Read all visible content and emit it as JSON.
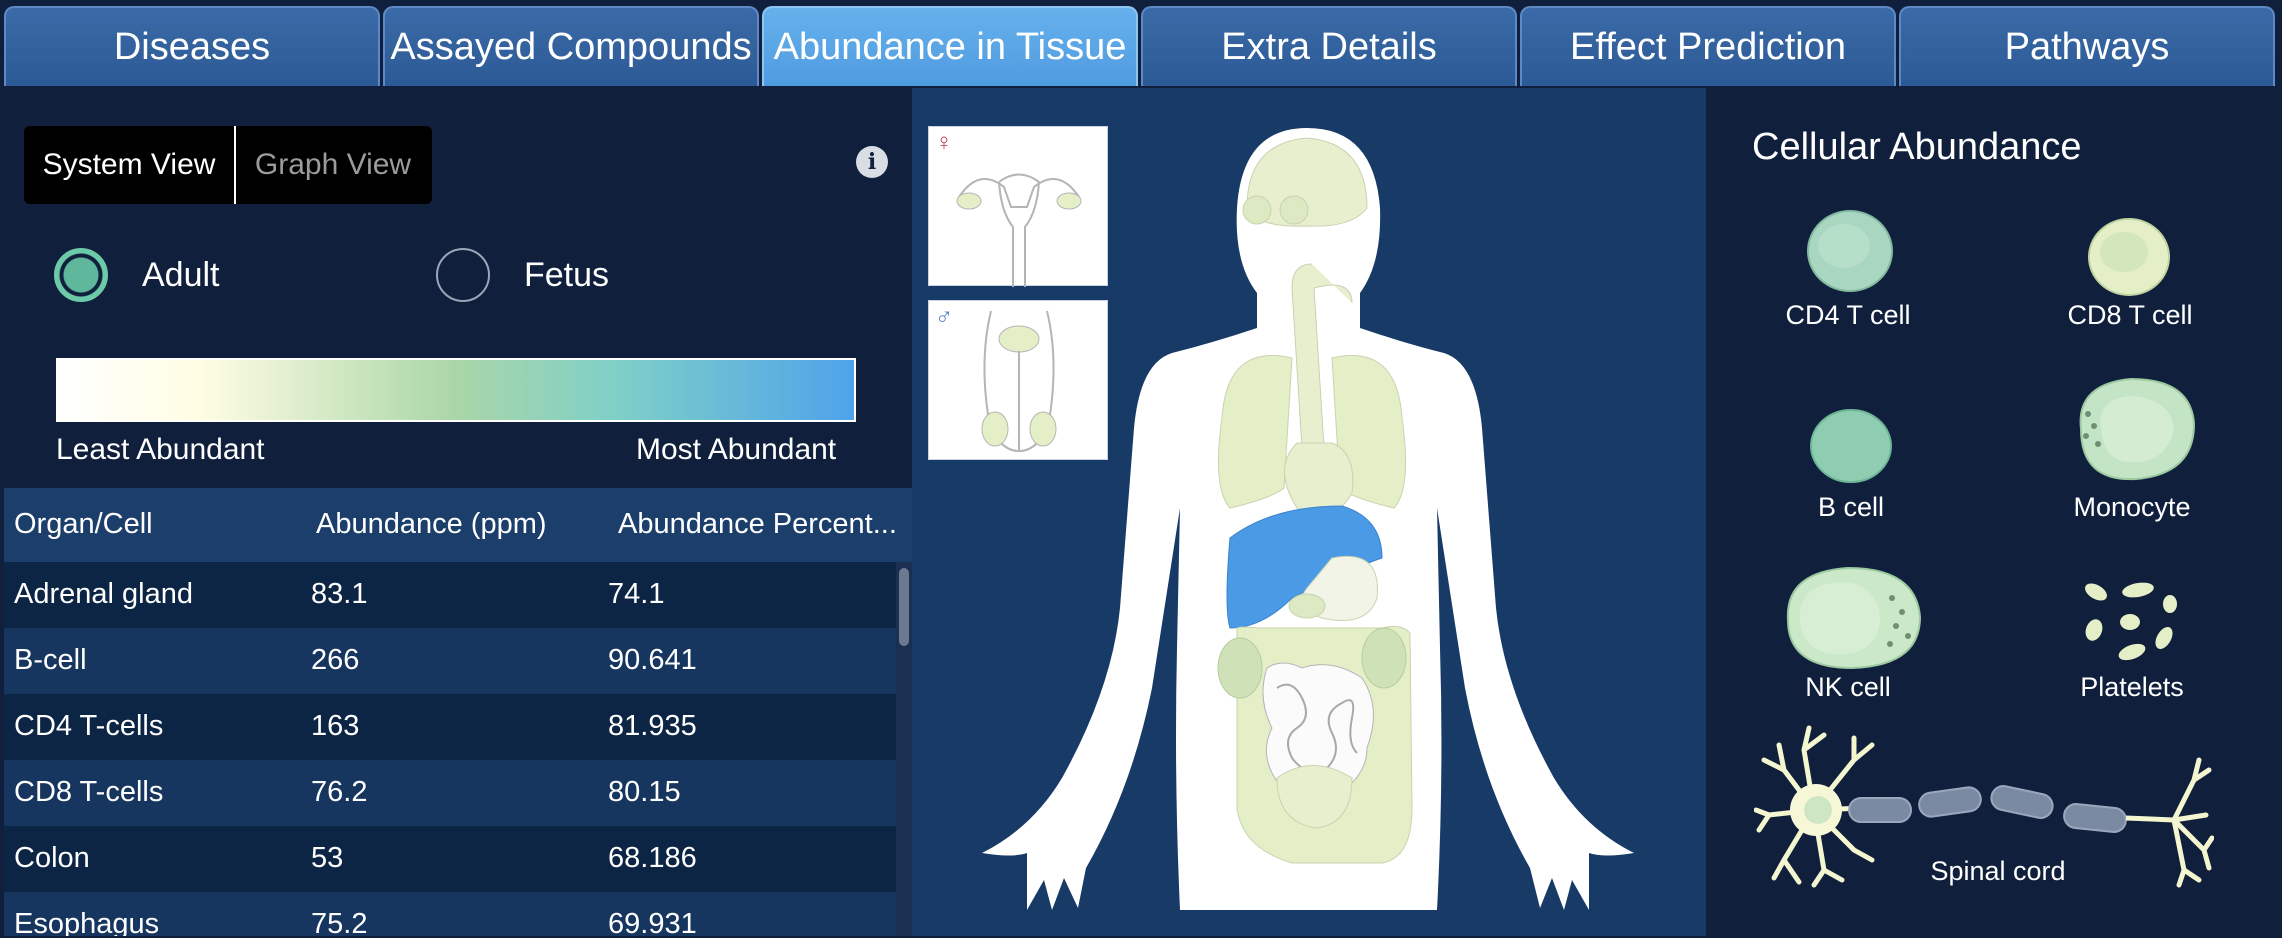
{
  "tabs": [
    "Diseases",
    "Assayed Compounds",
    "Abundance in Tissue",
    "Extra Details",
    "Effect Prediction",
    "Pathways"
  ],
  "active_tab": "Abundance in Tissue",
  "view_toggle": {
    "system": "System View",
    "graph": "Graph View",
    "selected": "System View"
  },
  "info_icon": "i",
  "age": {
    "adult": "Adult",
    "fetus": "Fetus",
    "selected": "Adult"
  },
  "legend": {
    "least": "Least Abundant",
    "most": "Most Abundant"
  },
  "table": {
    "headers": [
      "Organ/Cell",
      "Abundance (ppm)",
      "Abundance Percent..."
    ],
    "rows": [
      [
        "Adrenal gland",
        "83.1",
        "74.1"
      ],
      [
        "B-cell",
        "266",
        "90.641"
      ],
      [
        "CD4 T-cells",
        "163",
        "81.935"
      ],
      [
        "CD8 T-cells",
        "76.2",
        "80.15"
      ],
      [
        "Colon",
        "53",
        "68.186"
      ],
      [
        "Esophagus",
        "75.2",
        "69.931"
      ]
    ]
  },
  "reproductive": {
    "female_symbol": "♀",
    "male_symbol": "♂"
  },
  "cells": {
    "title": "Cellular Abundance",
    "items": {
      "cd4": "CD4 T cell",
      "cd8": "CD8 T cell",
      "bcell": "B cell",
      "monocyte": "Monocyte",
      "nk": "NK cell",
      "platelets": "Platelets",
      "spinal": "Spinal cord"
    }
  },
  "colors": {
    "least": "#fffde3",
    "mid": "#a9d6a8",
    "most": "#4ea3ea",
    "background": "#0f1f3c"
  }
}
